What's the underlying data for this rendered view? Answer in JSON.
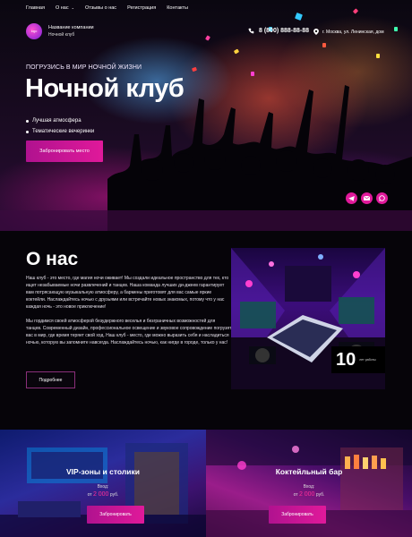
{
  "nav": {
    "items": [
      "Главная",
      "О нас",
      "Отзывы о нас",
      "Регистрация",
      "Контакты"
    ]
  },
  "header": {
    "logo_text": "logo",
    "company_name": "Название компании",
    "company_sub": "Ночной клуб",
    "phone": "8 (800) 888-88-88",
    "address": "г. Москва, ул. Ленинская, дом"
  },
  "hero": {
    "tagline": "ПОГРУЗИСЬ В МИР НОЧНОЙ ЖИЗНИ",
    "title": "Ночной клуб",
    "features": [
      "Лучшая атмосфера",
      "Тематические вечеринки"
    ],
    "button": "Забронировать место"
  },
  "socials": [
    "telegram-icon",
    "mail-icon",
    "whatsapp-icon"
  ],
  "about": {
    "title": "О нас",
    "paragraphs": [
      "Наш клуб - это место, где магия ночи оживает! Мы создали идеальное пространство для тех, кто ищет незабываемые ночи развлечений и танцев. Наша команда лучших ди-джеев гарантирует вам потрясающую музыкальную атмосферу, а бармены приготовят для вас самые яркие коктейли. Наслаждайтесь ночью с друзьями или встречайте новых знакомых, потому что у нас каждая ночь - это новое приключение!",
      "Мы гордимся своей атмосферой безудержного веселья и безграничных возможностей для танцев. Современный дизайн, профессиональное освещение и звуковое сопровождение погрузят вас в мир, где время теряет свой ход. Наш клуб - место, где можно выразить себя и насладиться ночью, которую вы запомните навсегда. Наслаждайтесь ночью, как нигде в городе, только у нас!"
    ],
    "button": "Подробнее",
    "years_num": "10",
    "years_label": "лет работы"
  },
  "cards": [
    {
      "title": "VIP-зоны и столики",
      "entry": "Вход:",
      "price_prefix": "от",
      "price": "2 000",
      "price_suffix": "руб.",
      "button": "Забронировать"
    },
    {
      "title": "Коктейльный бар",
      "entry": "Вход:",
      "price_prefix": "от",
      "price": "2 000",
      "price_suffix": "руб.",
      "button": "Забронировать"
    }
  ],
  "colors": {
    "accent": "#e0199a",
    "background": "#050308"
  }
}
